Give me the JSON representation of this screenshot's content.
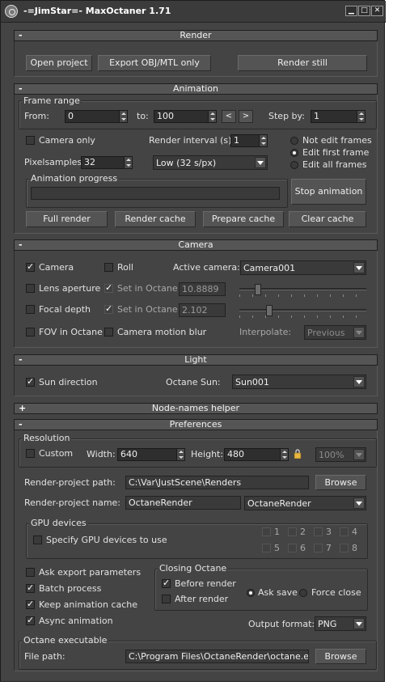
{
  "window": {
    "title": "-=JimStar=- MaxOctaner 1.71"
  },
  "render": {
    "header": "Render",
    "open_project": "Open project",
    "export_obj": "Export OBJ/MTL only",
    "render_still": "Render still"
  },
  "animation": {
    "header": "Animation",
    "frame_range": {
      "title": "Frame range",
      "from_label": "From:",
      "from": "0",
      "to_label": "to:",
      "to": "100",
      "prev": "<",
      "next": ">",
      "step_label": "Step by:",
      "step": "1"
    },
    "camera_only": "Camera only",
    "render_interval_label": "Render interval (s):",
    "render_interval": "1",
    "pixelsamples_label": "Pixelsamples:",
    "pixelsamples": "32",
    "quality": "Low (32 s/px)",
    "frame_modes": [
      "Not edit frames",
      "Edit first frame",
      "Edit all frames"
    ],
    "frame_mode_selected": 1,
    "progress_title": "Animation progress",
    "progress": 0,
    "stop_animation": "Stop animation",
    "full_render": "Full render",
    "render_cache": "Render cache",
    "prepare_cache": "Prepare cache",
    "clear_cache": "Clear cache"
  },
  "camera": {
    "header": "Camera",
    "camera": "Camera",
    "roll": "Roll",
    "active_camera_label": "Active camera:",
    "active_camera": "Camera001",
    "lens_aperture": "Lens aperture",
    "set_in_octane_1": "Set in Octane",
    "aperture_value": "10.8889",
    "aperture_slider": 0.13,
    "focal_depth": "Focal depth",
    "set_in_octane_2": "Set in Octane",
    "focal_value": "2.102",
    "focal_slider": 0.22,
    "fov_in_octane": "FOV in Octane",
    "camera_motion_blur": "Camera motion blur",
    "interpolate_label": "Interpolate:",
    "interpolate": "Previous"
  },
  "light": {
    "header": "Light",
    "sun_direction": "Sun direction",
    "octane_sun_label": "Octane Sun:",
    "octane_sun": "Sun001"
  },
  "node_names": {
    "header": "Node-names helper"
  },
  "preferences": {
    "header": "Preferences",
    "resolution_title": "Resolution",
    "custom": "Custom",
    "width_label": "Width:",
    "width": "640",
    "height_label": "Height:",
    "height": "480",
    "zoom": "100%",
    "render_path_label": "Render-project path:",
    "render_path": "C:\\Var\\JustScene\\Renders",
    "browse_1": "Browse",
    "render_name_label": "Render-project name:",
    "render_name": "OctaneRender",
    "render_name_select": "OctaneRender",
    "gpu_title": "GPU devices",
    "specify_gpu": "Specify GPU devices to use",
    "gpu_labels": [
      "1",
      "2",
      "3",
      "4",
      "5",
      "6",
      "7",
      "8"
    ],
    "ask_export": "Ask export parameters",
    "batch_process": "Batch process",
    "keep_animation_cache": "Keep animation cache",
    "async_animation": "Async animation",
    "closing_title": "Closing Octane",
    "before_render": "Before render",
    "after_render": "After render",
    "ask_save": "Ask save",
    "force_close": "Force close",
    "output_format_label": "Output format:",
    "output_format": "PNG",
    "executable_title": "Octane executable",
    "file_path_label": "File path:",
    "file_path": "C:\\Program Files\\OctaneRender\\octane.exe",
    "browse_2": "Browse"
  },
  "colors": {
    "window_bg": "#444444",
    "progress_fill": "#5a9ad8"
  }
}
